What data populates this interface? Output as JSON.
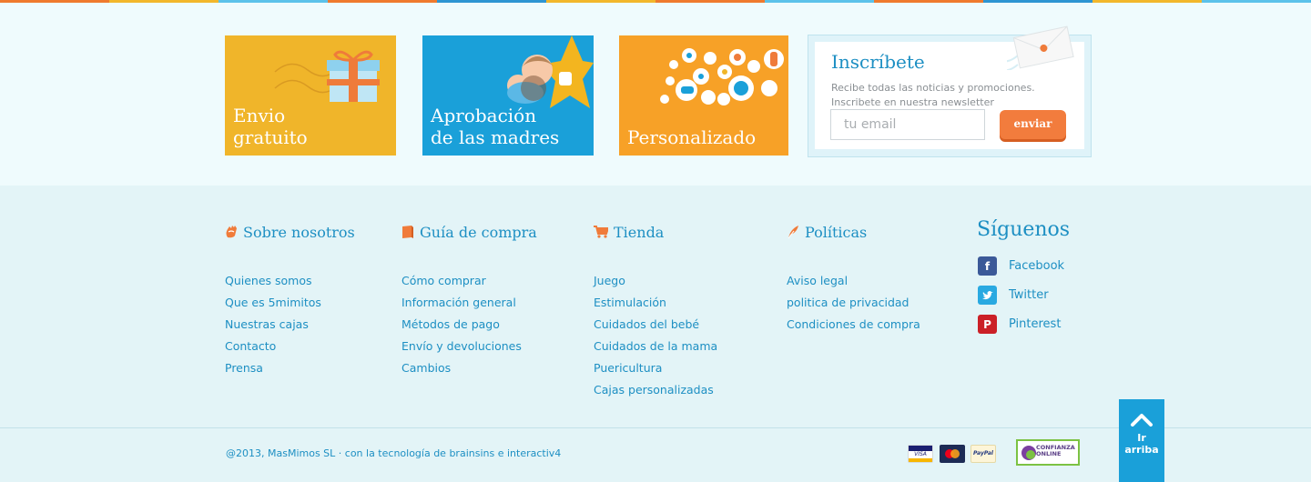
{
  "colors": {
    "stripe": [
      "#ef7a2e",
      "#f2b72c",
      "#5cc2ea",
      "#ef7a2e",
      "#2e95d2",
      "#f2b72c",
      "#ef7a2e",
      "#5cc2ea",
      "#ef7a2e",
      "#2e95d2",
      "#f2b72c",
      "#5cc2ea"
    ]
  },
  "promos": [
    {
      "label": "Envio\ngratuito",
      "icon": "gift-icon"
    },
    {
      "label": "Aprobación\nde las madres",
      "icon": "mother-star-icon"
    },
    {
      "label": "Personalizado",
      "icon": "baby-items-bubbles-icon"
    }
  ],
  "newsletter": {
    "title": "Inscríbete",
    "text": "Recibe todas las noticias y promociones. Inscribete en nuestra newsletter",
    "placeholder": "tu email",
    "button": "enviar",
    "icon": "envelope-icon"
  },
  "footer": {
    "columns": [
      {
        "title": "Sobre nosotros",
        "icon": "hand-icon",
        "links": [
          "Quienes somos",
          "Que es 5mimitos",
          "Nuestras cajas",
          "Contacto",
          "Prensa"
        ]
      },
      {
        "title": "Guía de compra",
        "icon": "book-icon",
        "links": [
          "Cómo comprar",
          "Información general",
          "Métodos de pago",
          "Envío y devoluciones",
          "Cambios"
        ]
      },
      {
        "title": "Tienda",
        "icon": "cart-icon",
        "links": [
          "Juego",
          "Estimulación",
          "Cuidados del bebé",
          "Cuidados de la mama",
          "Puericultura",
          "Cajas personalizadas"
        ]
      },
      {
        "title": "Políticas",
        "icon": "quill-icon",
        "links": [
          "Aviso legal",
          "politica de privacidad",
          "Condiciones de compra"
        ]
      }
    ],
    "social": {
      "title": "Síguenos",
      "items": [
        {
          "label": "Facebook",
          "icon": "facebook-icon",
          "glyph": "f",
          "color": "#3b5998"
        },
        {
          "label": "Twitter",
          "icon": "twitter-icon",
          "glyph": "t",
          "color": "#29a9e1"
        },
        {
          "label": "Pinterest",
          "icon": "pinterest-icon",
          "glyph": "P",
          "color": "#cb2027"
        }
      ]
    },
    "copyright": "@2013, MasMimos SL  ·  con la tecnología de brainsins e interactiv4",
    "payments": [
      "VISA",
      "mastercard",
      "PayPal"
    ],
    "trust_seal": "CONFIANZA ONLINE",
    "back_to_top": "Ir\narriba"
  }
}
